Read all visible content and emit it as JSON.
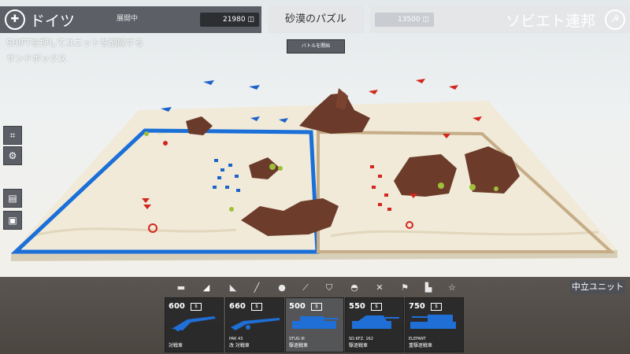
{
  "top": {
    "left_team": {
      "name": "ドイツ",
      "status": "展開中",
      "budget": "21980"
    },
    "map_title": "砂漠のパズル",
    "right_team": {
      "name": "ソビエト連邦",
      "budget": "13500"
    }
  },
  "battle_button": "バトルを開始",
  "hints": [
    "SHIFTを押してユニットを削除する",
    "サンドボックス"
  ],
  "side_tools": [
    "map-icon",
    "cannon-icon",
    "barrel-icon",
    "unit-box-icon"
  ],
  "categories": [
    "tank",
    "tank-destroyer",
    "artillery",
    "rifle",
    "syringe",
    "shield",
    "helmet",
    "tools",
    "factory",
    "star"
  ],
  "neutral_label": "中立ユニット",
  "units": [
    {
      "cost": "600",
      "name": "",
      "type": "対戦車"
    },
    {
      "cost": "660",
      "name": "PAK 43",
      "type": "改 対戦車"
    },
    {
      "cost": "500",
      "name": "STUG III",
      "type": "駆逐戦車"
    },
    {
      "cost": "550",
      "name": "SD.KFZ. 162",
      "type": "駆逐戦車"
    },
    {
      "cost": "750",
      "name": "ELEFANT",
      "type": "重駆逐戦車"
    }
  ],
  "colors": {
    "blue_team": "#1f6fd6",
    "red_team": "#d2261e",
    "panel_dark": "#5c5f66",
    "sand": "#efe8d6"
  }
}
